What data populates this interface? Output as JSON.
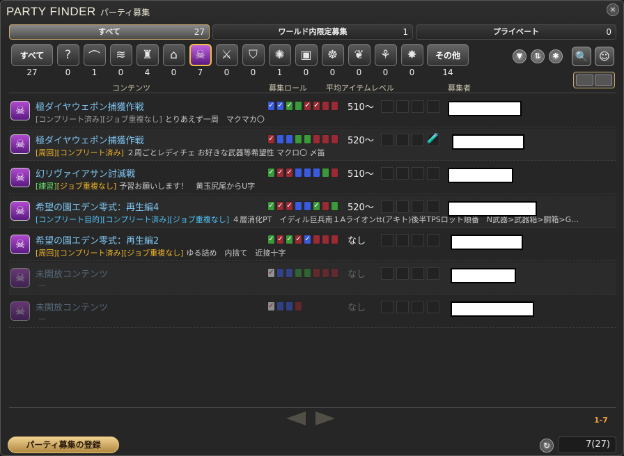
{
  "window": {
    "title_en": "PARTY FINDER",
    "title_jp": "パーティ募集",
    "close_icon": "×"
  },
  "tabs": [
    {
      "label": "すべて",
      "count": "27",
      "active": true
    },
    {
      "label": "ワールド内限定募集",
      "count": "1",
      "active": false
    },
    {
      "label": "プライベート",
      "count": "0",
      "active": false
    }
  ],
  "categories": {
    "all": {
      "label": "すべて",
      "count": "27"
    },
    "items": [
      {
        "icon": "question-icon",
        "glyph": "?",
        "count": "0"
      },
      {
        "icon": "dungeon-arch-icon",
        "glyph": "⌒",
        "count": "1"
      },
      {
        "icon": "scroll-icon",
        "glyph": "≋",
        "count": "0"
      },
      {
        "icon": "raid-mask-icon",
        "glyph": "♜",
        "count": "4"
      },
      {
        "icon": "castle-gate-icon",
        "glyph": "⌂",
        "count": "0"
      },
      {
        "icon": "trial-demon-icon",
        "glyph": "☠",
        "count": "7",
        "selected": true
      },
      {
        "icon": "crossed-swords-icon",
        "glyph": "⚔",
        "count": "0"
      },
      {
        "icon": "pvp-shield-icon",
        "glyph": "⛉",
        "count": "0"
      },
      {
        "icon": "orb-icon",
        "glyph": "✺",
        "count": "1"
      },
      {
        "icon": "treasure-chest-icon",
        "glyph": "▣",
        "count": "0"
      },
      {
        "icon": "fates-icon",
        "glyph": "☸",
        "count": "0"
      },
      {
        "icon": "feather-icon",
        "glyph": "❦",
        "count": "0"
      },
      {
        "icon": "gathering-icon",
        "glyph": "⚘",
        "count": "0"
      },
      {
        "icon": "hunt-icon",
        "glyph": "✸",
        "count": "0"
      }
    ],
    "other": {
      "label": "その他",
      "count": "14"
    }
  },
  "tools": {
    "filter_icon": "▼",
    "sort_icon": "⇅",
    "settings_icon": "✱",
    "search_icon": "🔍",
    "party_icon": "☺"
  },
  "columns": {
    "content": "コンテンツ",
    "roles": "募集ロール",
    "ilvl": "平均アイテムレベル",
    "recruiter": "募集者"
  },
  "listings": [
    {
      "duty": "極ダイヤウェポン捕獲作戦",
      "tags": [
        {
          "text": "[コンプリート済み][ジョブ重複なし]",
          "color": "grey"
        }
      ],
      "comment": "とりあえず一周　マクマカ〇",
      "slots": [
        [
          "b",
          "✓"
        ],
        [
          "b",
          "✓"
        ],
        [
          "g",
          "✓"
        ],
        [
          "g",
          ""
        ],
        [
          "r",
          "✓"
        ],
        [
          "r",
          "✓"
        ],
        [
          "r",
          ""
        ],
        [
          "r",
          ""
        ]
      ],
      "ilvl": "510〜",
      "dim": false
    },
    {
      "duty": "極ダイヤウェポン捕獲作戦",
      "tags": [
        {
          "text": "[周回]",
          "color": "yellow"
        },
        {
          "text": "[コンプリート済み]",
          "color": "yellow"
        }
      ],
      "comment": "２周ごとレディチェ お好きな武器等希望性 マクロ〇 〆笛",
      "slots": [
        [
          "r",
          "✓"
        ],
        [
          "b",
          ""
        ],
        [
          "b",
          ""
        ],
        [
          "g",
          ""
        ],
        [
          "g",
          ""
        ],
        [
          "r",
          ""
        ],
        [
          "r",
          ""
        ],
        [
          "r",
          ""
        ]
      ],
      "ilvl": "520〜",
      "extra": "🧪",
      "dim": false
    },
    {
      "duty": "幻リヴァイアサン討滅戦",
      "tags": [
        {
          "text": "[練習]",
          "color": "green"
        },
        {
          "text": "[ジョブ重複なし]",
          "color": "yellow"
        }
      ],
      "comment": "予習お願いします！　黄玉尻尾からU字",
      "slots": [
        [
          "g",
          "✓"
        ],
        [
          "r",
          "✓"
        ],
        [
          "r",
          "✓"
        ],
        [
          "b",
          ""
        ],
        [
          "b",
          ""
        ],
        [
          "b",
          ""
        ],
        [
          "g",
          ""
        ],
        [
          "r",
          ""
        ]
      ],
      "ilvl": "510〜",
      "dim": false
    },
    {
      "duty": "希望の園エデン零式：再生編4",
      "tags": [
        {
          "text": "[コンプリート目的][コンプリート済み][ジョブ重複なし]",
          "color": "blue"
        }
      ],
      "comment": "４層消化PT　イディル巨兵南１Aライオンtt(アキト)後半TPSロット順番　N武器>武器箱>胴箱>G…",
      "slots": [
        [
          "g",
          "✓"
        ],
        [
          "r",
          "✓"
        ],
        [
          "r",
          "✓"
        ],
        [
          "b",
          ""
        ],
        [
          "b",
          ""
        ],
        [
          "g",
          "✓"
        ],
        [
          "r",
          ""
        ],
        [
          "g",
          ""
        ]
      ],
      "ilvl": "520〜",
      "dim": false
    },
    {
      "duty": "希望の園エデン零式：再生編2",
      "tags": [
        {
          "text": "[周回][コンプリート済み][ジョブ重複なし]",
          "color": "yellow"
        }
      ],
      "comment": "ゆる詰め　内捨て　近接十字",
      "slots": [
        [
          "g",
          "✓"
        ],
        [
          "r",
          "✓"
        ],
        [
          "g",
          "✓"
        ],
        [
          "r",
          "✓"
        ],
        [
          "b",
          "✓"
        ],
        [
          "r",
          ""
        ],
        [
          "r",
          ""
        ],
        [
          "r",
          ""
        ]
      ],
      "ilvl": "なし",
      "dim": false
    },
    {
      "duty": "未開放コンテンツ",
      "tags": [],
      "comment": "—",
      "slots": [
        [
          "w",
          "✓"
        ],
        [
          "b",
          ""
        ],
        [
          "b",
          ""
        ],
        [
          "g",
          ""
        ],
        [
          "g",
          ""
        ],
        [
          "r",
          ""
        ],
        [
          "r",
          ""
        ],
        [
          "r",
          ""
        ]
      ],
      "ilvl": "なし",
      "dim": true
    },
    {
      "duty": "未開放コンテンツ",
      "tags": [],
      "comment": "—",
      "slots": [
        [
          "w",
          "✓"
        ],
        [
          "b",
          ""
        ],
        [
          "b",
          ""
        ],
        [
          "r",
          ""
        ]
      ],
      "ilvl": "なし",
      "dim": true
    }
  ],
  "pager": {
    "range": "1-7"
  },
  "footer": {
    "register_label": "パーティ募集の登録",
    "total": "7(27)",
    "refresh_icon": "↻"
  }
}
